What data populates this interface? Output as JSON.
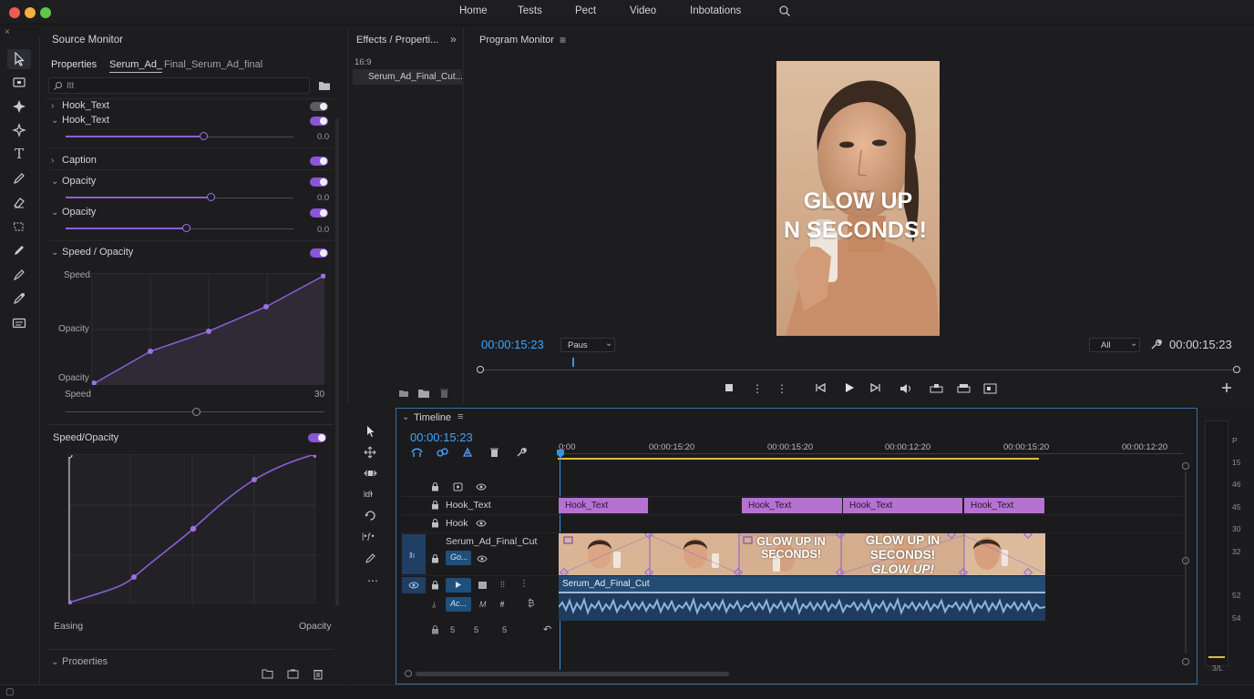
{
  "nav": {
    "items": [
      "Home",
      "Tests",
      "Pect",
      "Video",
      "Inbotations"
    ]
  },
  "source": {
    "title": "Source Monitor",
    "tab_properties": "Properties",
    "tab_clip": "Serum_Ad_",
    "tab_clip_extra": "Final_Serum_Ad_final",
    "search_placeholder": "Itt",
    "rows": [
      {
        "label": "Hook_Text",
        "value": ""
      },
      {
        "label": "Hook_Text",
        "value": "0.0"
      },
      {
        "label": "Caption",
        "value": ""
      },
      {
        "label": "Opacity",
        "value": "0.0"
      },
      {
        "label": "Opacity",
        "value": "0.0"
      },
      {
        "label": "Speed / Opacity",
        "value": ""
      }
    ],
    "graph1": {
      "label_top": "Speed",
      "label_mid": "Opacity",
      "label_bottom": "Opacity",
      "label_axis": "Speed",
      "axis_value": "30"
    },
    "graph2": {
      "title": "Speed/Opacity",
      "x_label_left": "Easing",
      "x_label_right": "Opacity"
    },
    "footer_section": "Properties"
  },
  "effects": {
    "title": "Effects / Properti...",
    "ratio": "16:9",
    "item": "Serum_Ad_Final_Cut..."
  },
  "program": {
    "title": "Program Monitor",
    "overlay_line1": "GLOW UP",
    "overlay_line2": "N SECONDS!",
    "timecode_left": "00:00:15:23",
    "dropdown_left": "Paus",
    "dropdown_right": "All",
    "timecode_right": "00:00:15:23"
  },
  "timeline": {
    "title": "Timeline",
    "timecode": "00:00:15:23",
    "ruler": [
      "0:00",
      "00:00:15:20",
      "00:00:15:20",
      "00:00:12:20",
      "00:00:15:20",
      "00:00:12:20"
    ],
    "tracks": [
      {
        "name": "Hook_Text"
      },
      {
        "name": "Hook"
      },
      {
        "name": "Serum_Ad_Final_Cut",
        "badge": "Go..."
      },
      {
        "name": "",
        "badge": "Ac..."
      }
    ],
    "track_footer_numbers": [
      "5",
      "5",
      "5"
    ],
    "text_clips": [
      "Hook_Text",
      "Hook_Text",
      "Hook_Text",
      "Hook_Text"
    ],
    "video_overlay_1": "GLOW UP IN SECONDS!",
    "video_overlay_2a": "GLOW UP IN",
    "video_overlay_2b": "SECONDS!",
    "video_overlay_2c": "GLOW UP!",
    "audio_clip": "Serum_Ad_Final_Cut"
  },
  "meter": {
    "labels": [
      "P",
      "15",
      "46",
      "45",
      "30",
      "32",
      "52",
      "54",
      "3/L"
    ]
  },
  "colors": {
    "accent": "#8a55d6",
    "clip": "#b671d2",
    "playhead": "#3b8fe8",
    "timecode": "#3fa4ff"
  }
}
